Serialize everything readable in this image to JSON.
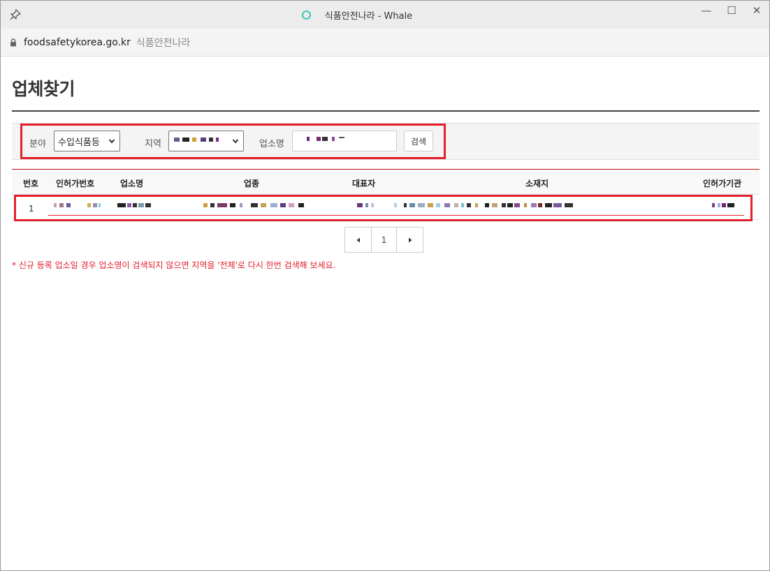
{
  "browser": {
    "title": "식품안전나라 - Whale",
    "url": "foodsafetykorea.go.kr",
    "page_name": "식품안전나라",
    "controls": {
      "minimize": "—",
      "maximize": "☐",
      "close": "✕"
    }
  },
  "page": {
    "title": "업체찾기"
  },
  "search": {
    "field_label": "분야",
    "field_value": "수입식품등",
    "region_label": "지역",
    "company_label": "업소명",
    "search_button": "검색"
  },
  "table": {
    "headers": [
      "번호",
      "인허가번호",
      "업소명",
      "업종",
      "대표자",
      "소재지",
      "인허가기관"
    ],
    "rows": [
      {
        "no": "1"
      }
    ]
  },
  "pagination": {
    "current": "1",
    "prev_icon": "caret-left-icon",
    "next_icon": "caret-right-icon"
  },
  "notice": "* 신규 등록 업소일 경우 업소명이 검색되지 않으면 지역을 '전체'로 다시 한번 검색해 보세요.",
  "colors": {
    "highlight": "#e4202a",
    "accent": "#3cc8b4"
  }
}
